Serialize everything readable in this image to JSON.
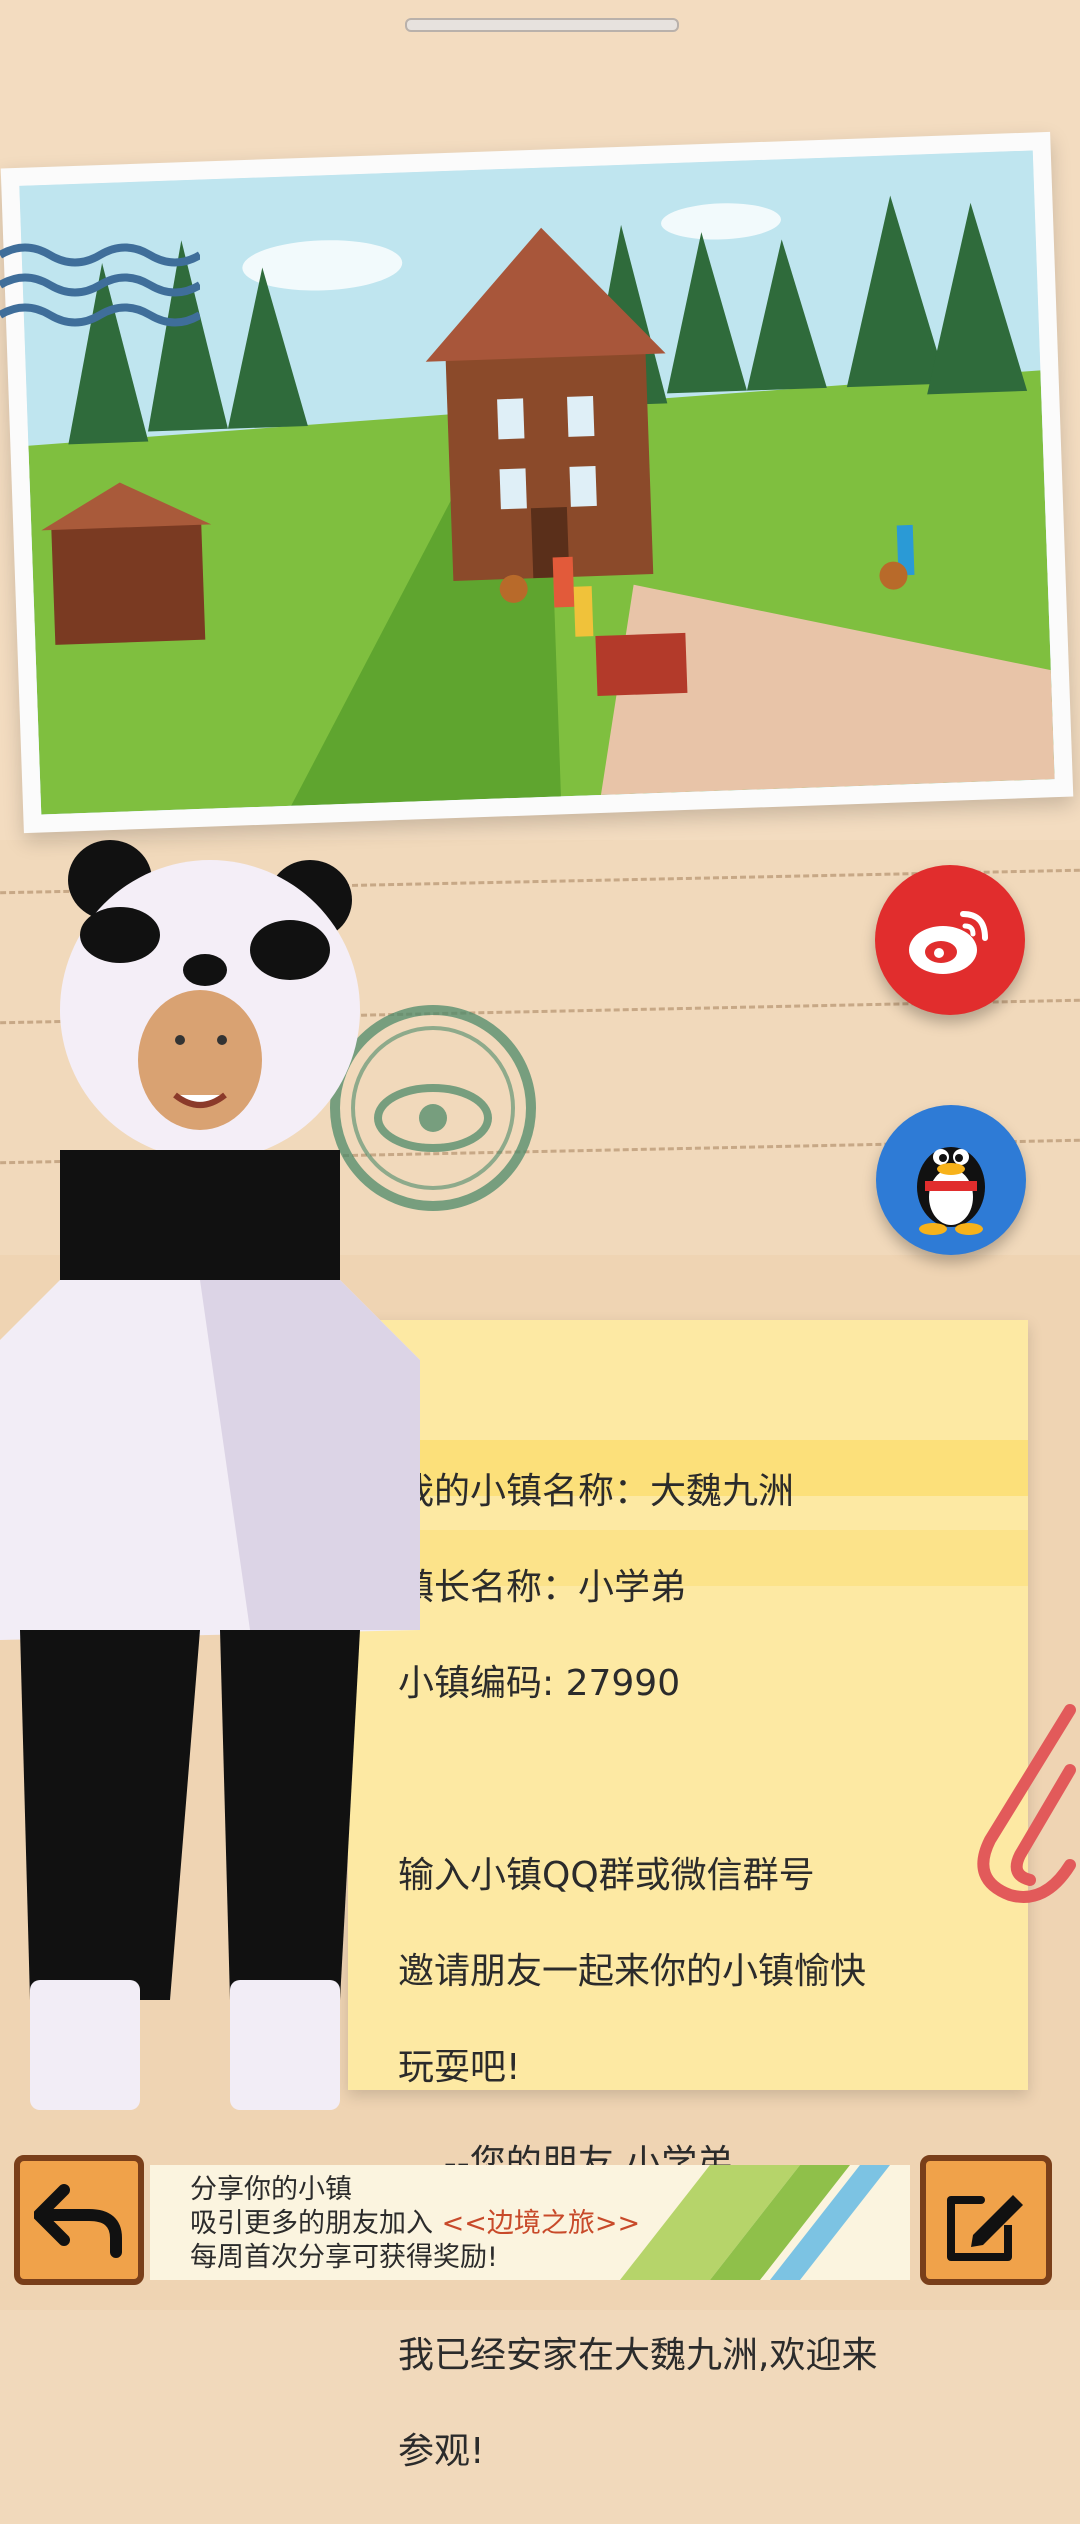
{
  "colors": {
    "background": "#f1d9bb",
    "note": "#fde9a3",
    "weibo": "#e12d2d",
    "qq": "#2e7bd6",
    "button_orange": "#f0a24a",
    "highlight": "#c84a2a"
  },
  "share": {
    "weibo_icon": "weibo-icon",
    "qq_icon": "qq-penguin-icon"
  },
  "note": {
    "line1": "我的小镇名称：大魏九洲",
    "line2": "镇长名称：小学弟",
    "line3": "小镇编码: 27990",
    "line4": "输入小镇QQ群或微信群号",
    "line5": "邀请朋友一起来你的小镇愉快",
    "line6": "玩耍吧!",
    "line7": "    --您的朋友 小学弟",
    "line8": "我已经安家在大魏九洲,欢迎来",
    "line9": "参观!"
  },
  "bottom": {
    "back_icon": "back-arrow-icon",
    "edit_icon": "edit-pencil-icon",
    "banner_line1": "分享你的小镇",
    "banner_line2_prefix": "吸引更多的朋友加入",
    "banner_line2_highlight": "<<边境之旅>>",
    "banner_line3": "每周首次分享可获得奖励!"
  }
}
